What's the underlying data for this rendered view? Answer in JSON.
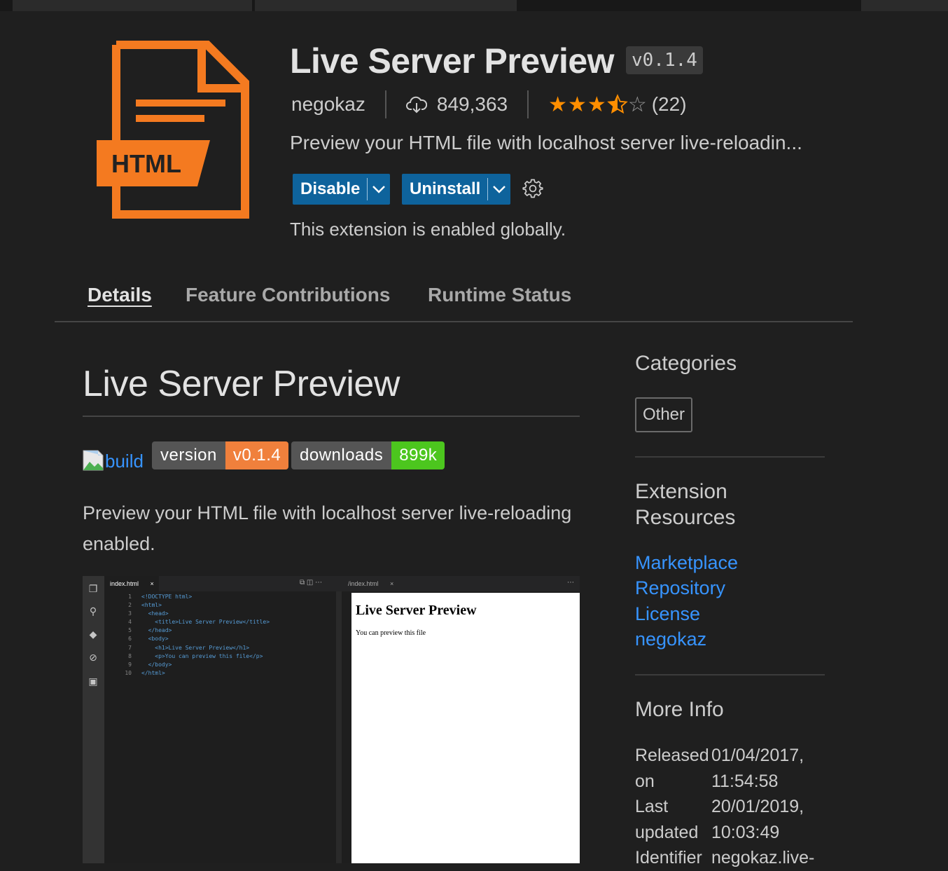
{
  "header": {
    "title": "Live Server Preview",
    "version": "v0.1.4",
    "publisher": "negokaz",
    "installs": "849,363",
    "rating_value": 3.5,
    "rating_count": "(22)",
    "short_description": "Preview your HTML file with localhost server live-reloadin...",
    "disable_label": "Disable",
    "uninstall_label": "Uninstall",
    "status_message": "This extension is enabled globally.",
    "logo_text": "HTML",
    "accent_color": "#f47a20",
    "button_color": "#0e639c"
  },
  "tabs": [
    {
      "label": "Details",
      "active": true
    },
    {
      "label": "Feature Contributions",
      "active": false
    },
    {
      "label": "Runtime Status",
      "active": false
    }
  ],
  "readme": {
    "title": "Live Server Preview",
    "build_alt": "build",
    "badge_version_label": "version",
    "badge_version_value": "v0.1.4",
    "badge_downloads_label": "downloads",
    "badge_downloads_value": "899k",
    "description": "Preview your HTML file with localhost server live-reloading enabled.",
    "screenshot": {
      "editor_tab": "index.html",
      "preview_tab": "/index.html",
      "code_lines": [
        "<!DOCTYPE html>",
        "<html>",
        "  <head>",
        "    <title>Live Server Preview</title>",
        "  </head>",
        "  <body>",
        "    <h1>Live Server Preview</h1>",
        "    <p>You can preview this file</p>",
        "  </body>",
        "</html>"
      ],
      "preview_heading": "Live Server Preview",
      "preview_text": "You can preview this file"
    }
  },
  "sidebar": {
    "categories_title": "Categories",
    "category": "Other",
    "resources_title": "Extension Resources",
    "resources": [
      "Marketplace",
      "Repository",
      "License",
      "negokaz"
    ],
    "more_info_title": "More Info",
    "info": [
      {
        "key": "Released on",
        "value": "01/04/2017, 11:54:58"
      },
      {
        "key": "Last updated",
        "value": "20/01/2019, 10:03:49"
      },
      {
        "key": "Identifier",
        "value": "negokaz.live-"
      }
    ]
  }
}
